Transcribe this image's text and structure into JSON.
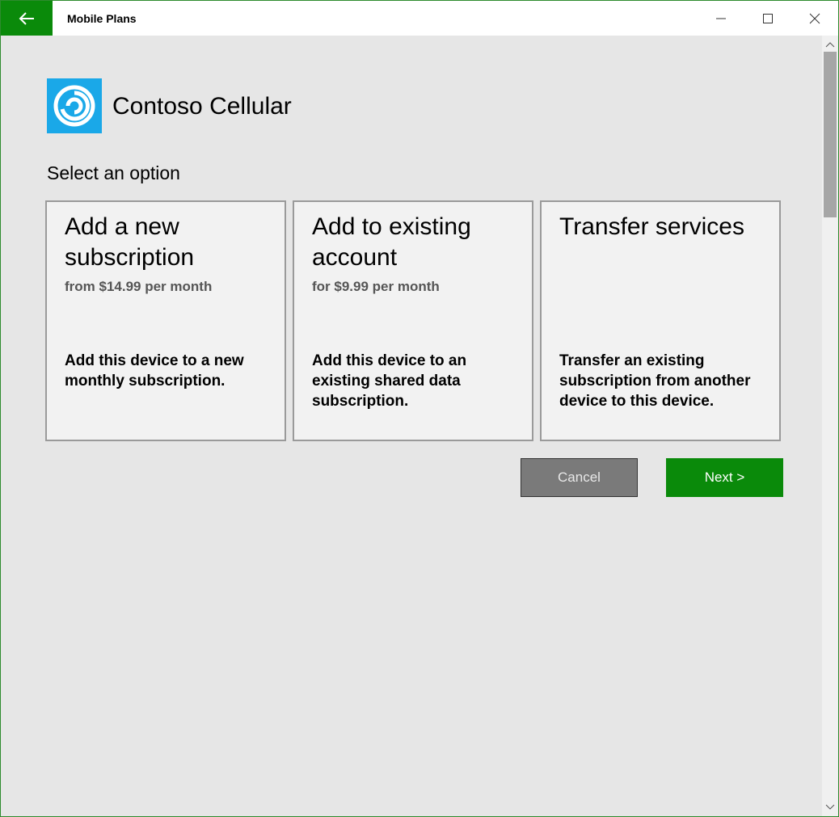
{
  "window": {
    "title": "Mobile Plans"
  },
  "header": {
    "carrier_name": "Contoso Cellular"
  },
  "main": {
    "section_title": "Select an option",
    "options": [
      {
        "title": "Add a new subscription",
        "price": "from $14.99 per month",
        "description": "Add this device to a new monthly subscription."
      },
      {
        "title": "Add to existing account",
        "price": "for $9.99 per month",
        "description": "Add this device to an existing shared data subscription."
      },
      {
        "title": "Transfer services",
        "price": "",
        "description": "Transfer an existing subscription from another device to this device."
      }
    ]
  },
  "actions": {
    "cancel_label": "Cancel",
    "next_label": "Next >"
  },
  "icons": {
    "back": "back-arrow-icon",
    "minimize": "minimize-icon",
    "maximize": "maximize-icon",
    "close": "close-icon",
    "logo": "contoso-logo-icon"
  },
  "colors": {
    "accent_green": "#0a8a0a",
    "logo_blue": "#1aa8e8",
    "background": "#e6e6e6",
    "card": "#f2f2f2"
  }
}
